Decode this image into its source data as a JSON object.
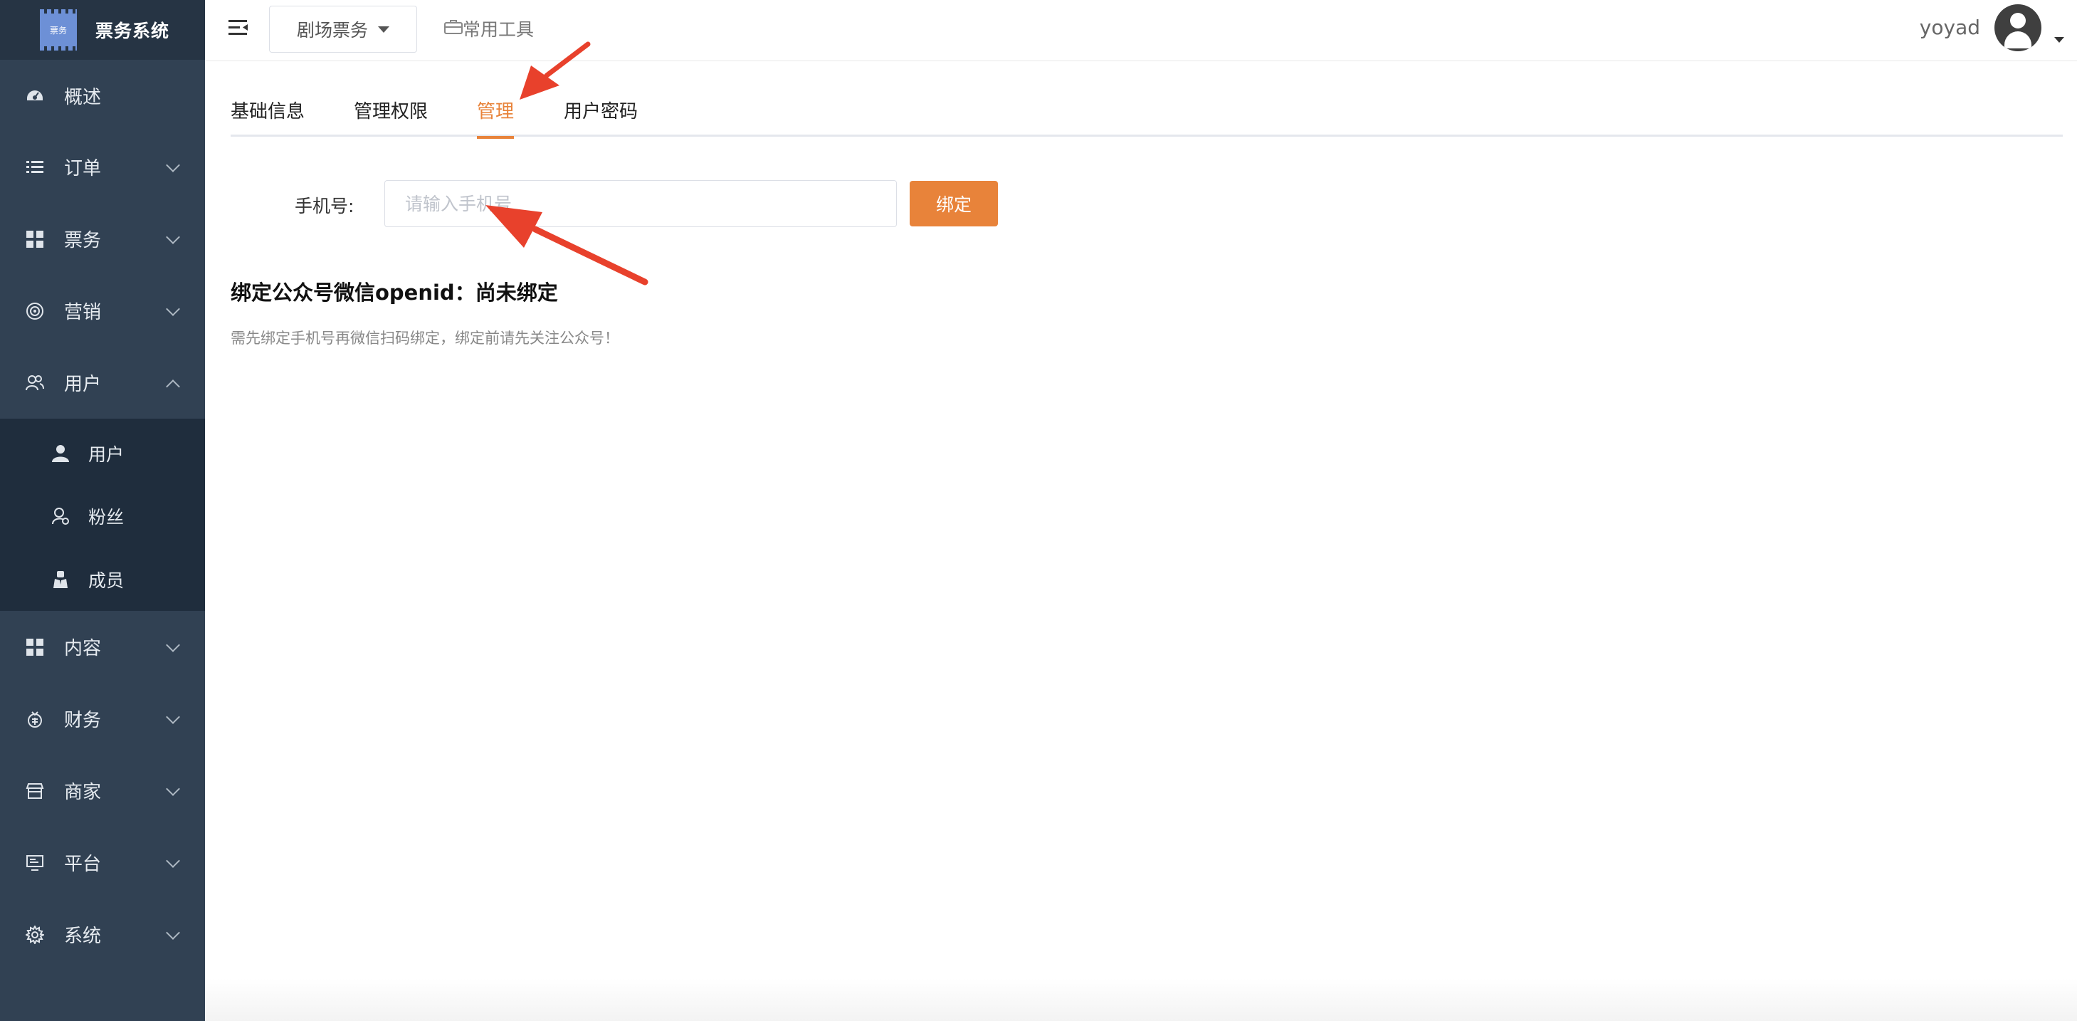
{
  "app": {
    "logo_text": "票务",
    "title": "票务系统"
  },
  "sidebar": {
    "items": [
      {
        "label": "概述",
        "icon": "dashboard-icon"
      },
      {
        "label": "订单",
        "icon": "list-icon"
      },
      {
        "label": "票务",
        "icon": "grid-icon"
      },
      {
        "label": "营销",
        "icon": "target-icon"
      },
      {
        "label": "用户",
        "icon": "users-icon"
      },
      {
        "label": "内容",
        "icon": "grid-icon"
      },
      {
        "label": "财务",
        "icon": "money-icon"
      },
      {
        "label": "商家",
        "icon": "store-icon"
      },
      {
        "label": "平台",
        "icon": "monitor-icon"
      },
      {
        "label": "系统",
        "icon": "gear-icon"
      }
    ],
    "user_submenu": [
      {
        "label": "用户",
        "icon": "person-icon"
      },
      {
        "label": "粉丝",
        "icon": "fans-icon"
      },
      {
        "label": "成员",
        "icon": "member-icon"
      }
    ]
  },
  "header": {
    "theater_select": "剧场票务",
    "tools_label": "常用工具",
    "username": "yoyad"
  },
  "tabs": [
    {
      "label": "基础信息",
      "active": false
    },
    {
      "label": "管理权限",
      "active": false
    },
    {
      "label": "管理",
      "active": true
    },
    {
      "label": "用户密码",
      "active": false
    }
  ],
  "form": {
    "phone_label": "手机号:",
    "phone_placeholder": "请输入手机号",
    "phone_value": "",
    "bind_button": "绑定"
  },
  "openid_status": "绑定公众号微信openid：尚未绑定",
  "hint": "需先绑定手机号再微信扫码绑定，绑定前请先关注公众号！",
  "colors": {
    "accent": "#e8833a",
    "sidebar": "#314153",
    "sidebar_dark": "#1f2d3d",
    "annotation": "#e8412c"
  }
}
